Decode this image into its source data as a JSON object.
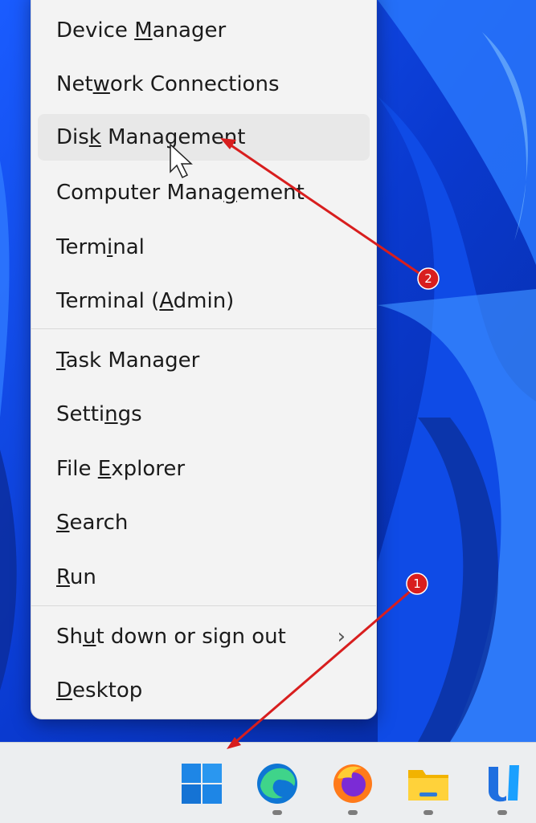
{
  "menu": {
    "items": [
      {
        "label": "Device Manager",
        "access_key": "M"
      },
      {
        "label": "Network Connections",
        "access_key": "w"
      },
      {
        "label": "Disk Management",
        "access_key": "k"
      },
      {
        "label": "Computer Management",
        "access_key": "g"
      },
      {
        "label": "Terminal",
        "access_key": "i"
      },
      {
        "label": "Terminal (Admin)",
        "access_key": "A"
      },
      {
        "label": "Task Manager",
        "access_key": "T"
      },
      {
        "label": "Settings",
        "access_key": "n"
      },
      {
        "label": "File Explorer",
        "access_key": "E"
      },
      {
        "label": "Search",
        "access_key": "S"
      },
      {
        "label": "Run",
        "access_key": "R"
      },
      {
        "label": "Shut down or sign out",
        "access_key": "u",
        "submenu_glyph": "›"
      },
      {
        "label": "Desktop",
        "access_key": "D"
      }
    ],
    "hovered": "Disk Management"
  },
  "annotations": {
    "badge1": "1",
    "badge2": "2",
    "color": "#d81e1e"
  },
  "taskbar": {
    "icons": [
      "windows-start-icon",
      "edge-icon",
      "firefox-icon",
      "file-explorer-icon",
      "app-icon"
    ]
  }
}
